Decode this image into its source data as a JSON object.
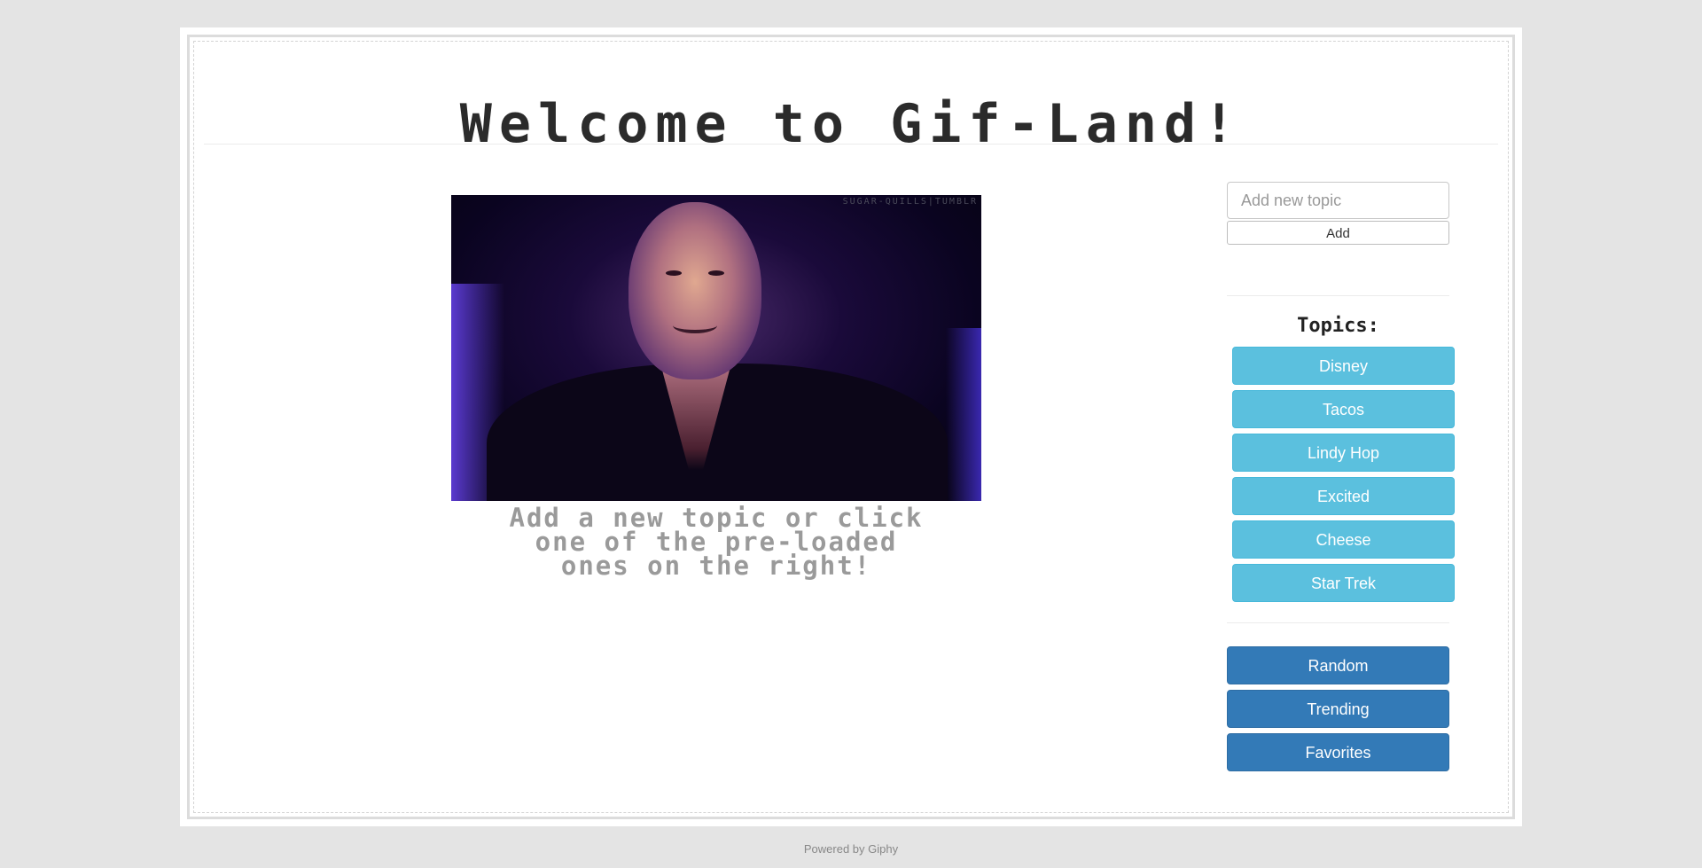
{
  "header": {
    "title": "Welcome to Gif-Land!"
  },
  "gif": {
    "watermark": "SUGAR-QUILLS|TUMBLR"
  },
  "prompt": {
    "text": "Add a new topic or click one of the pre-loaded ones on the right!"
  },
  "sidebar": {
    "topic_input_placeholder": "Add new topic",
    "add_label": "Add",
    "topics_heading": "Topics:",
    "topics": [
      {
        "label": "Disney"
      },
      {
        "label": "Tacos"
      },
      {
        "label": "Lindy Hop"
      },
      {
        "label": "Excited"
      },
      {
        "label": "Cheese"
      },
      {
        "label": "Star Trek"
      }
    ],
    "actions": [
      {
        "label": "Random"
      },
      {
        "label": "Trending"
      },
      {
        "label": "Favorites"
      }
    ]
  },
  "footer": {
    "text": "Powered by Giphy"
  },
  "colors": {
    "topic_button": "#5bc0de",
    "action_button": "#337ab7",
    "page_background": "#e4e4e4"
  }
}
